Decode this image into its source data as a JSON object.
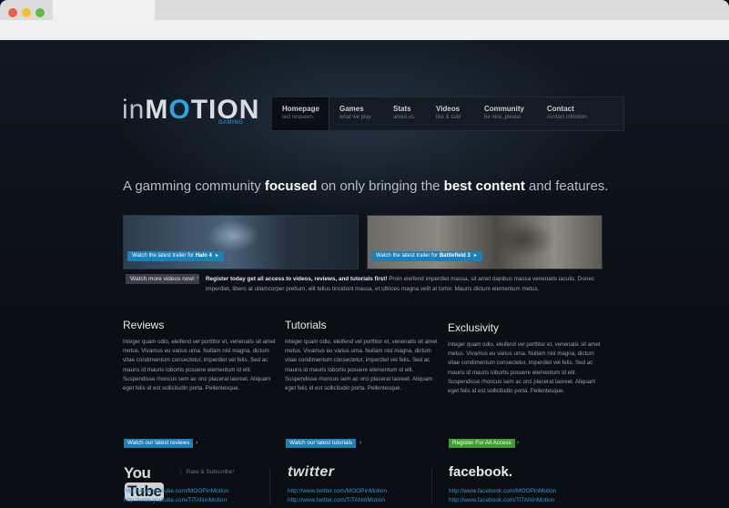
{
  "brand": {
    "logo_in": "in",
    "logo_m": "M",
    "logo_o": "O",
    "logo_tion": "TION",
    "logo_sub": "GAMING",
    "accent": "#28a6e0"
  },
  "nav": [
    {
      "label": "Homepage",
      "sub": "last respawn."
    },
    {
      "label": "Games",
      "sub": "what we play."
    },
    {
      "label": "Stats",
      "sub": "about us."
    },
    {
      "label": "Videos",
      "sub": "like & sub!"
    },
    {
      "label": "Community",
      "sub": "be nice, please."
    },
    {
      "label": "Contact",
      "sub": "contact inMotion."
    }
  ],
  "tagline": {
    "p1": "A gamming community ",
    "b1": "focused",
    "p2": " on only bringing the ",
    "b2": "best content",
    "p3": " and features."
  },
  "trailers": [
    {
      "prefix": "Watch the latest trailer for ",
      "game": "Halo 4"
    },
    {
      "prefix": "Watch the latest trailer for ",
      "game": "Battlefield 3"
    }
  ],
  "more_videos": "Watch more videos now!",
  "register": {
    "bold": "Register today get all access to videos, reviews, and tutorials first!",
    "text": " Proin eleifend imperdiet massa, sit amet dapibus massa venenatis iaculis. Donec imperdiet, libero at ullamcorper pretium, elit tellus tincidunt massa, et ultrices magna velit at tortor. Mauris dictum elementum metus."
  },
  "columns": [
    {
      "title": "Reviews",
      "text": "Integer quam odio, eleifend vel porttitor et, venenatis sit amet metus. Vivamus eu varius urna. Nullam nisl magna, dictum vitae condimentum consectetur, imperdiet vel felis. Sed ac mauris id mauris lobortis posuere elementum id elit. Suspendisse rhoncus sem ac orci placerat laoreet. Aliquam eget felis id est sollicitudin porta. Pellentesque.",
      "button": "Watch our latest reviews"
    },
    {
      "title": "Tutorials",
      "text": "Integer quam odio, eleifend vel porttitor et, venenatis sit amet metus. Vivamus eu varius urna. Nullam nisl magna, dictum vitae condimentum consectetur, imperdiet vel felis. Sed ac mauris id mauris lobortis posuere elementum id elit. Suspendisse rhoncus sem ac orci placerat laoreet. Aliquam eget felis id est sollicitudin porta. Pellentesque.",
      "button": "Watch our latest tutorials"
    },
    {
      "title": "Exclusivity",
      "text": "Integer quam odio, eleifend vel porttitor et, venenatis sit amet metus. Vivamus eu varius urna. Nullam nisl magna, dictum vitae condimentum consectetur, imperdiet vel felis. Sed ac mauris id mauris lobortis posuere elementum id elit. Suspendisse rhoncus sem ac orci placerat laoreet. Aliquam eget felis id est sollicitudin porta. Pellentesque.",
      "button": "Register For All Access"
    }
  ],
  "social": {
    "youtube": {
      "logo_you": "You",
      "logo_tube": "Tube",
      "sep": "|",
      "subtitle": "Rate & Subscribe!",
      "links": [
        "http://www.youtube.com/MOOPinMotion",
        "http://www.youtube.com/TiTANinMotion"
      ]
    },
    "twitter": {
      "logo": "twitter",
      "links": [
        "http://www.twitter.com/MOOPinMotion",
        "http://www.twitter.com/TiTANinMotion"
      ]
    },
    "facebook": {
      "logo": "facebook.",
      "links": [
        "http://www.facebook.com/MOOPinMotion",
        "http://www.facebook.com/TiTANinMotion"
      ]
    }
  }
}
